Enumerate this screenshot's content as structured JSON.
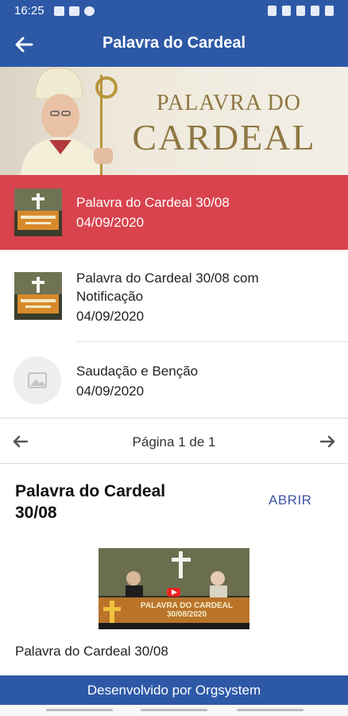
{
  "status_bar": {
    "time": "16:25"
  },
  "app_bar": {
    "title": "Palavra do Cardeal",
    "back_icon": "arrow-left-icon"
  },
  "banner": {
    "line1": "PALAVRA DO",
    "line2": "CARDEAL"
  },
  "list": {
    "items": [
      {
        "title": "Palavra do Cardeal 30/08",
        "date": "04/09/2020",
        "selected": true,
        "thumb": "video-thumbnail"
      },
      {
        "title": "Palavra do Cardeal 30/08 com Notificação",
        "date": "04/09/2020",
        "selected": false,
        "thumb": "video-thumbnail"
      },
      {
        "title": "Saudação e Benção",
        "date": "04/09/2020",
        "selected": false,
        "thumb": "image-placeholder-icon"
      }
    ]
  },
  "pager": {
    "label": "Página 1 de 1"
  },
  "detail": {
    "title": "Palavra do Cardeal 30/08",
    "open_label": "ABRIR",
    "video_caption_line1": "PALAVRA DO CARDEAL",
    "video_caption_line2": "30/08/2020",
    "caption": "Palavra do Cardeal 30/08"
  },
  "footer": {
    "text": "Desenvolvido por Orgsystem"
  },
  "colors": {
    "primary": "#2d58a6",
    "selected_row": "#d8434e",
    "accent_link": "#3f57a6"
  }
}
